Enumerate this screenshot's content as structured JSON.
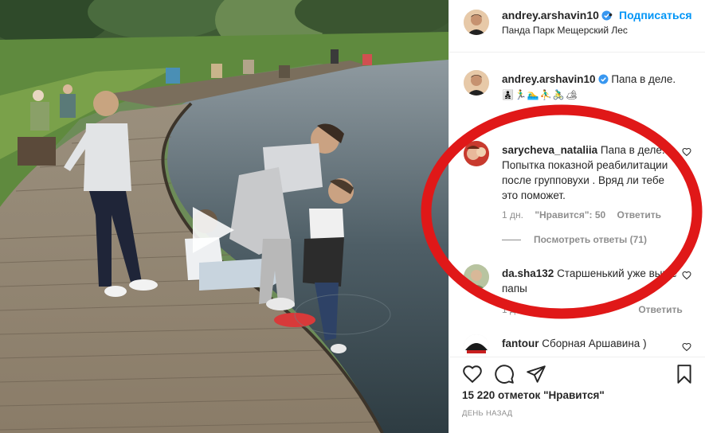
{
  "post": {
    "username": "andrey.arshavin10",
    "follow_label": "Подписаться",
    "location": "Панда Парк Мещерский Лес",
    "dot": "•"
  },
  "comments": [
    {
      "username": "andrey.arshavin10",
      "text": "Папа в деле.",
      "text2": "👨‍👦‍👦🏃‍♂️🏊‍♂️⛹️‍♂️🚴‍♂️🏕",
      "is_caption": true
    },
    {
      "username": "sarycheva_nataliia",
      "text": "Папа в деле. Попытка показной реабилитации после групповухи . Вряд ли тебе это поможет.",
      "time": "1 дн.",
      "likes": "\"Нравится\": 50",
      "reply": "Ответить",
      "view_replies": "Посмотреть ответы (71)"
    },
    {
      "username": "da.sha132",
      "text": "Старшенький уже выше папы",
      "time": "1 дн.",
      "reply": "Ответить"
    },
    {
      "username": "fantour",
      "text": "Сборная Аршавина )"
    }
  ],
  "footer": {
    "likes_text": "15 220 отметок \"Нравится\"",
    "date": "ДЕНЬ НАЗАД"
  },
  "icons": {
    "header_verified": "verified-badge-icon",
    "like": "heart-icon",
    "comment": "comment-icon",
    "share": "share-icon",
    "save": "bookmark-icon",
    "play": "play-icon"
  },
  "colors": {
    "accent": "#0095f6",
    "annotation": "#e01818",
    "text": "#262626",
    "muted": "#8e8e8e"
  }
}
